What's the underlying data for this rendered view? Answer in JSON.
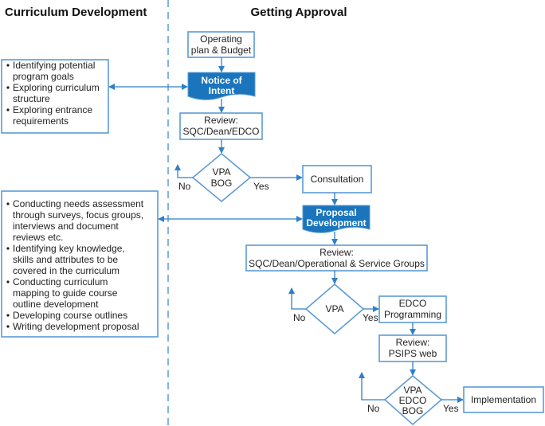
{
  "headers": {
    "left": "Curriculum Development",
    "right": "Getting Approval"
  },
  "left_boxes": [
    [
      "Identifying potential",
      "program goals",
      "Exploring curriculum",
      "structure",
      "Exploring entrance",
      "requirements"
    ],
    [
      "Conducting needs assessment",
      "through surveys, focus groups,",
      "interviews and document",
      "reviews etc.",
      "Identifying key knowledge,",
      "skills and attributes to be",
      "covered in the curriculum",
      "Conducting curriculum",
      "mapping to guide course",
      "outline development",
      "Developing course outlines",
      "Writing development proposal"
    ]
  ],
  "nodes": {
    "operating": [
      "Operating",
      "plan & Budget"
    ],
    "notice": [
      "Notice of",
      "Intent"
    ],
    "review1": [
      "Review:",
      "SQC/Dean/EDCO"
    ],
    "decision1": [
      "VPA",
      "BOG"
    ],
    "consultation": "Consultation",
    "proposal": [
      "Proposal",
      "Development"
    ],
    "review2": [
      "Review:",
      "SQC/Dean/Operational & Service Groups"
    ],
    "decision2": "VPA",
    "edco": [
      "EDCO",
      "Programming"
    ],
    "review3": [
      "Review:",
      "PSIPS web"
    ],
    "decision3": [
      "VPA",
      "EDCO",
      "BOG"
    ],
    "implementation": "Implementation"
  },
  "labels": {
    "no": "No",
    "yes": "Yes"
  },
  "colors": {
    "accent": "#1a75bc",
    "outline": "#5b9bd5"
  }
}
